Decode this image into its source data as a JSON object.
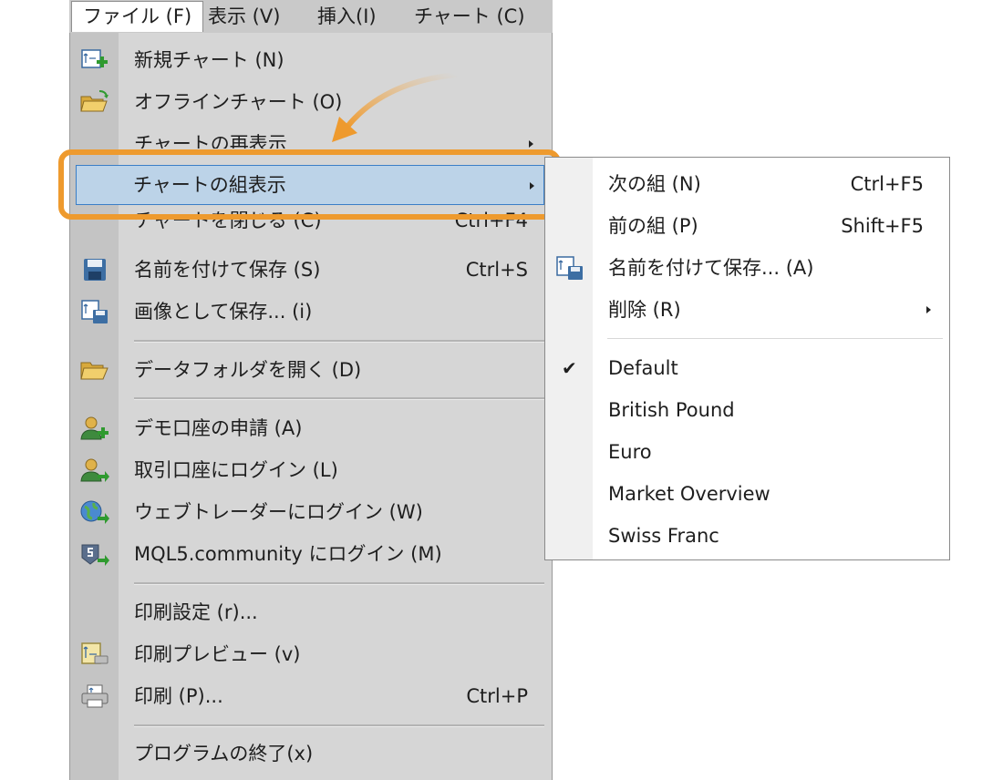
{
  "menubar": {
    "items": [
      {
        "label": "ファイル (F)",
        "active": true
      },
      {
        "label": "表示 (V)"
      },
      {
        "label": "挿入(I)"
      },
      {
        "label": "チャート (C)"
      }
    ]
  },
  "file_menu": {
    "new_chart": "新規チャート (N)",
    "offline_chart": "オフラインチャート (O)",
    "redisplay_chart": "チャートの再表示",
    "profiles": "チャートの組表示",
    "close_chart": "チャートを閉じる (C)",
    "close_chart_shortcut": "Ctrl+F4",
    "save_as": "名前を付けて保存 (S)",
    "save_as_shortcut": "Ctrl+S",
    "save_as_picture": "画像として保存... (i)",
    "open_data_folder": "データフォルダを開く (D)",
    "open_demo_account": "デモ口座の申請 (A)",
    "login_trade_account": "取引口座にログイン (L)",
    "login_webtrader": "ウェブトレーダーにログイン (W)",
    "login_mql5": "MQL5.community にログイン (M)",
    "print_setup": "印刷設定 (r)...",
    "print_preview": "印刷プレビュー (v)",
    "print": "印刷 (P)...",
    "print_shortcut": "Ctrl+P",
    "exit": "プログラムの終了(x)"
  },
  "profiles_submenu": {
    "next": "次の組 (N)",
    "next_shortcut": "Ctrl+F5",
    "previous": "前の組 (P)",
    "previous_shortcut": "Shift+F5",
    "save_as": "名前を付けて保存... (A)",
    "delete": "削除 (R)",
    "profiles": [
      "Default",
      "British Pound",
      "Euro",
      "Market Overview",
      "Swiss Franc"
    ],
    "checked_profile": "Default"
  },
  "colors": {
    "highlight_fill": "#bcd3e8",
    "highlight_border": "#3a7ec7",
    "callout": "#ee9a2e"
  }
}
